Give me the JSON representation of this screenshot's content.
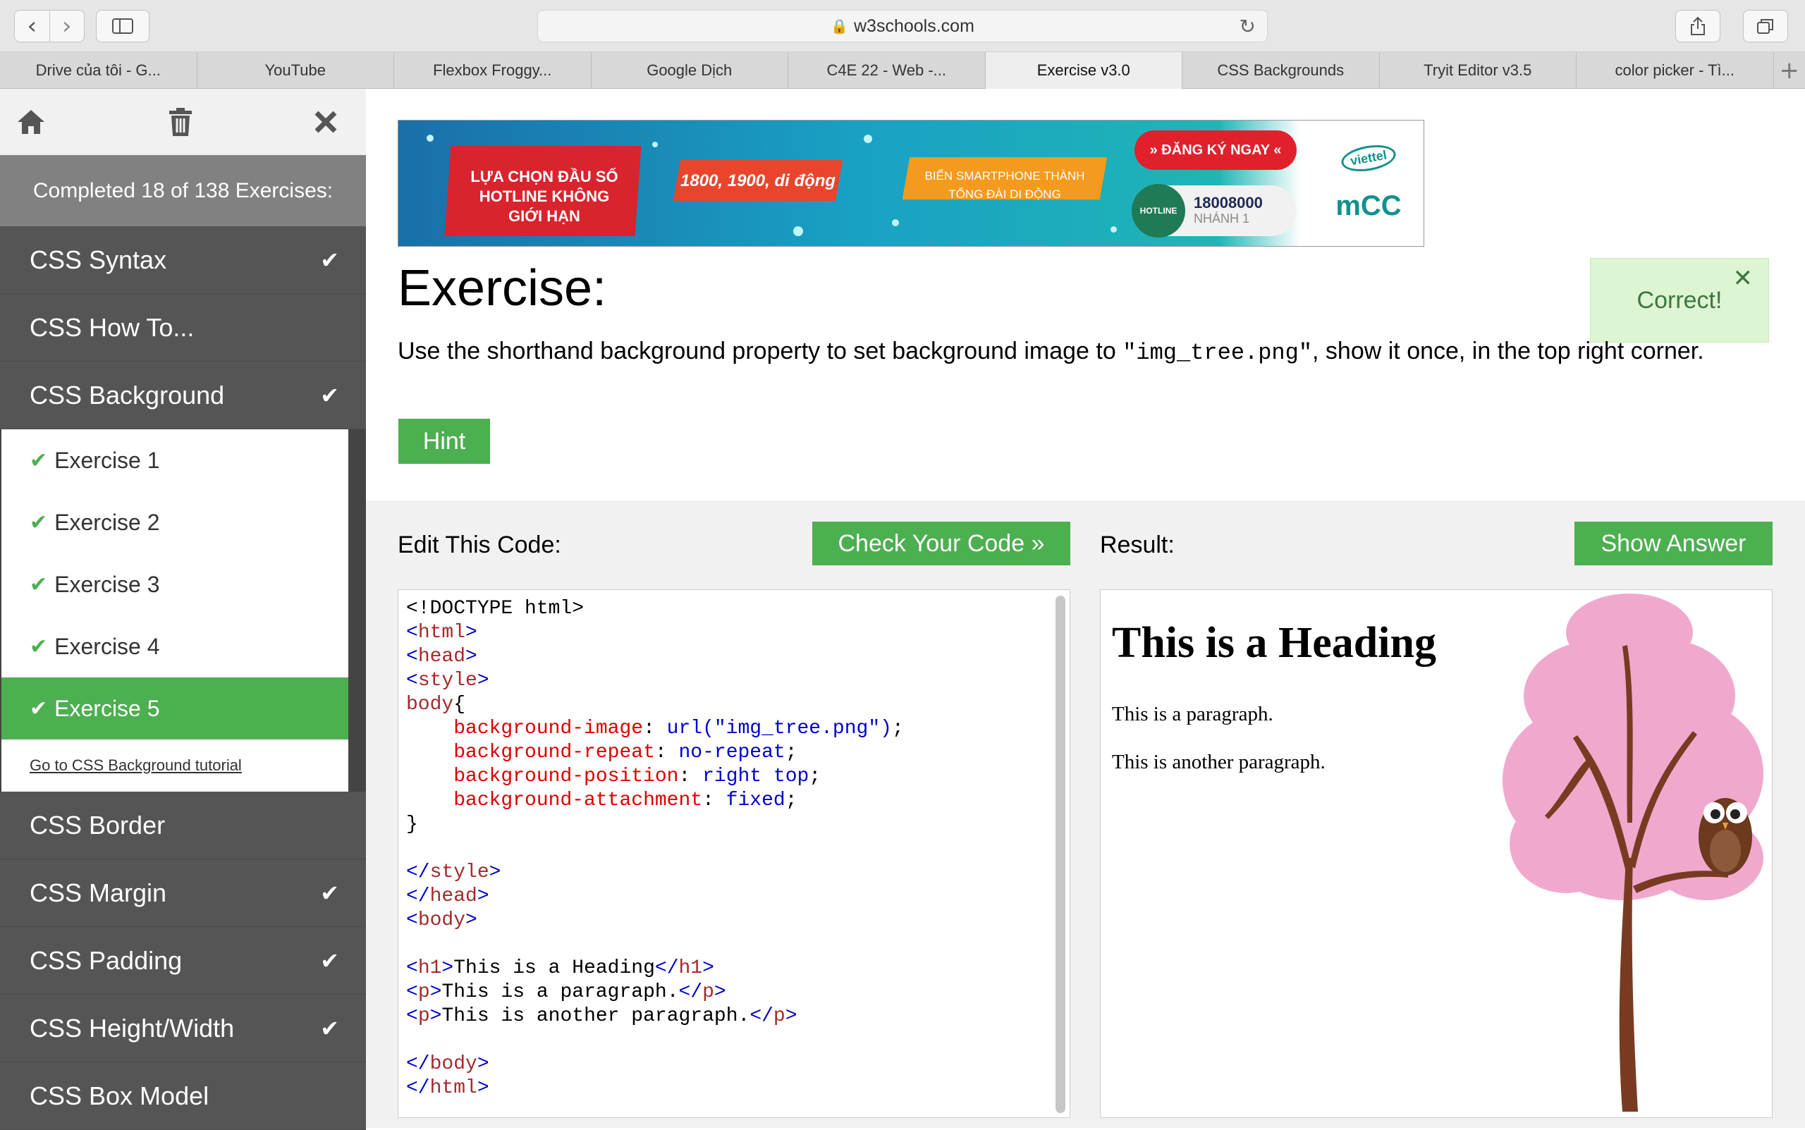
{
  "browser": {
    "url": "w3schools.com",
    "tabs": [
      {
        "label": "Drive của tôi - G..."
      },
      {
        "label": "YouTube"
      },
      {
        "label": "Flexbox Froggy..."
      },
      {
        "label": "Google Dịch"
      },
      {
        "label": "C4E 22 - Web -..."
      },
      {
        "label": "Exercise v3.0",
        "active": true
      },
      {
        "label": "CSS Backgrounds"
      },
      {
        "label": "Tryit Editor v3.5"
      },
      {
        "label": "color picker - Tì..."
      }
    ]
  },
  "sidebar": {
    "completed_text": "Completed 18 of 138 Exercises:",
    "items": [
      {
        "label": "CSS Syntax",
        "done": true
      },
      {
        "label": "CSS How To...",
        "done": false
      },
      {
        "label": "CSS Background",
        "done": true
      }
    ],
    "subitems": [
      {
        "label": "Exercise 1"
      },
      {
        "label": "Exercise 2"
      },
      {
        "label": "Exercise 3"
      },
      {
        "label": "Exercise 4"
      },
      {
        "label": "Exercise 5",
        "active": true
      }
    ],
    "tutorial_link": "Go to CSS Background tutorial",
    "items_after": [
      {
        "label": "CSS Border",
        "done": false
      },
      {
        "label": "CSS Margin",
        "done": true
      },
      {
        "label": "CSS Padding",
        "done": true
      },
      {
        "label": "CSS Height/Width",
        "done": true
      },
      {
        "label": "CSS Box Model",
        "done": false
      }
    ]
  },
  "ad": {
    "text1": "LỰA CHỌN ĐẦU SỐ HOTLINE KHÔNG GIỚI HẠN",
    "text2": "1800, 1900, di động",
    "text3": "BIẾN SMARTPHONE THÀNH TỔNG ĐÀI DI ĐỘNG",
    "cta": "» ĐĂNG KÝ NGAY «",
    "hotline_badge": "HOTLINE",
    "hotline_number": "18008000",
    "hotline_branch": "NHÁNH 1",
    "brand1": "viettel",
    "brand2": "mCC"
  },
  "exercise": {
    "title": "Exercise:",
    "instruction_pre": "Use the shorthand background property to set background image to ",
    "instruction_code": "\"img_tree.png\"",
    "instruction_post": ", show it once, in the top right corner.",
    "hint_label": "Hint",
    "correct_label": "Correct!"
  },
  "editor": {
    "label": "Edit This Code:",
    "check_label": "Check Your Code »"
  },
  "result": {
    "label": "Result:",
    "show_answer_label": "Show Answer",
    "heading": "This is a Heading",
    "p1": "This is a paragraph.",
    "p2": "This is another paragraph."
  },
  "colors": {
    "accent_green": "#4caf50",
    "sidebar_dark": "#555555",
    "correct_bg": "#ddf5d2"
  }
}
